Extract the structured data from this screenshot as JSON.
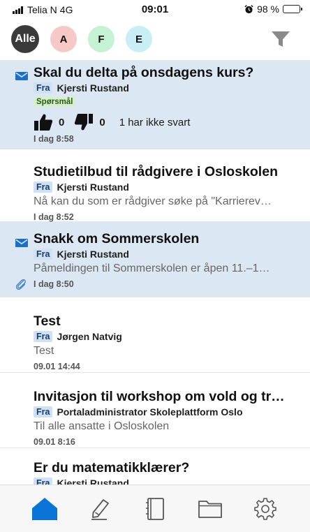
{
  "status_bar": {
    "carrier": "Telia N",
    "network": "4G",
    "time": "09:01",
    "battery_text": "98 %",
    "battery_level": 0.98
  },
  "filters": {
    "chips": [
      {
        "label": "Alle",
        "selected": true
      },
      {
        "label": "A",
        "color": "#f6c8c8"
      },
      {
        "label": "F",
        "color": "#c5f2d2"
      },
      {
        "label": "E",
        "color": "#c9eef6"
      }
    ],
    "filter_icon": "funnel-icon"
  },
  "messages": [
    {
      "title": "Skal du delta på onsdagens kurs?",
      "from_label": "Fra",
      "from": "Kjersti Rustand",
      "tag": "Spørsmål",
      "votes": {
        "up": "0",
        "down": "0",
        "no_answer": "1 har ikke svart"
      },
      "time": "I dag 8:58",
      "unread": true
    },
    {
      "title": "Studietilbud til rådgivere i Osloskolen",
      "from_label": "Fra",
      "from": "Kjersti Rustand",
      "preview": "Nå kan du som er rådgiver søke på \"Karrierev…",
      "time": "I dag 8:52",
      "unread": false
    },
    {
      "title": "Snakk om Sommerskolen",
      "from_label": "Fra",
      "from": "Kjersti Rustand",
      "preview": "Påmeldingen til Sommerskolen er åpen 11.–1…",
      "time": "I dag 8:50",
      "unread": true,
      "attachment": true
    },
    {
      "title": "Test",
      "from_label": "Fra",
      "from": "Jørgen Natvig",
      "preview": "Test",
      "time": "09.01 14:44",
      "unread": false
    },
    {
      "title": "Invitasjon til workshop om vold og tr…",
      "from_label": "Fra",
      "from": "Portaladministrator Skoleplattform Oslo",
      "preview": "Til alle ansatte i Osloskolen",
      "time": "09.01 8:16",
      "unread": false
    },
    {
      "title": "Er du matematikklærer?",
      "from_label": "Fra",
      "from": "Kjersti Rustand",
      "unread": false
    }
  ],
  "tab_bar": {
    "tabs": [
      {
        "icon": "home-icon",
        "active": true
      },
      {
        "icon": "pencil-icon"
      },
      {
        "icon": "notebook-icon"
      },
      {
        "icon": "folder-icon"
      },
      {
        "icon": "gear-icon"
      }
    ],
    "active_color": "#0a74d6"
  }
}
